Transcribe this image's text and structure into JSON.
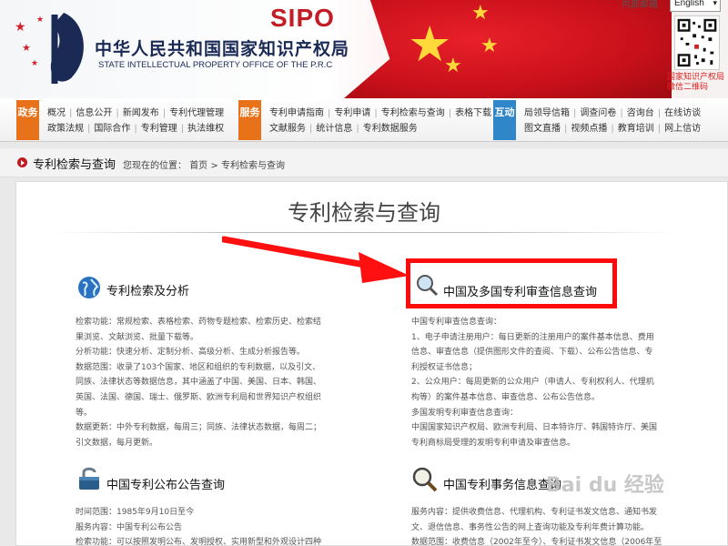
{
  "header": {
    "sipo_logo": "SIPO",
    "cn_title": "中华人民共和国国家知识产权局",
    "en_title": "STATE INTELLECTUAL PROPERTY OFFICE OF THE P.R.C",
    "mail_link": "内部邮箱",
    "language_selected": "English",
    "qr_caption": "国家知识产权局微信二维码",
    "brand_red": "#c21d24",
    "brand_navy": "#1a2a55"
  },
  "nav": {
    "gov": {
      "badge": "政务",
      "row1": [
        "概况",
        "信息公开",
        "新闻发布",
        "专利代理管理"
      ],
      "row2": [
        "政策法规",
        "国际合作",
        "专利管理",
        "执法维权"
      ]
    },
    "service": {
      "badge": "服务",
      "row1": [
        "专利申请指南",
        "专利申请",
        "专利检索与查询",
        "表格下载"
      ],
      "row2": [
        "文献服务",
        "统计信息",
        "专利数据服务"
      ]
    },
    "interact": {
      "badge": "互动",
      "row1": [
        "局领导信箱",
        "调查问卷",
        "咨询台",
        "在线访谈"
      ],
      "row2": [
        "图文直播",
        "视频点播",
        "教育培训",
        "网上信访"
      ]
    }
  },
  "breadcrumb": {
    "title": "专利检索与查询",
    "location_label": "您现在的位置：",
    "home": "首页",
    "separator": ">",
    "current": "专利检索与查询"
  },
  "main": {
    "title": "专利检索与查询",
    "sections": {
      "analysis": {
        "title": "专利检索及分析",
        "lines": [
          "检索功能：常规检索、表格检索、药物专题检索、检索历史、检索结",
          "果浏览、文献浏览、批量下载等。",
          "分析功能：快速分析、定制分析、高级分析、生成分析报告等。",
          "数据范围：收录了103个国家、地区和组织的专利数据，以及引文、",
          "同族、法律状态等数据信息，其中涵盖了中国、美国、日本、韩国、",
          "英国、法国、德国、瑞士、俄罗斯、欧洲专利局和世界知识产权组织",
          "等。",
          "数据更新：中外专利数据，每周三；同族、法律状态数据，每周二；",
          "引文数据，每月更新。"
        ]
      },
      "examination": {
        "title": "中国及多国专利审查信息查询",
        "lines": [
          "中国专利审查信息查询：",
          "1、电子申请注册用户：每日更新的注册用户的案件基本信息、费用",
          "信息、审查信息（提供图形文件的查阅、下载）、公布公告信息、专",
          "利授权证书信息；",
          "2、公众用户：每周更新的公众用户（申请人、专利权利人、代理机",
          "构等）的案件基本信息、审查信息、公布公告信息。",
          "多国发明专利审查信息查询：",
          "中国国家知识产权局、欧洲专利局、日本特许厅、韩国特许厅、美国",
          "专利商标局受理的发明专利申请及审查信息。"
        ]
      },
      "publication": {
        "title": "中国专利公布公告查询",
        "lines": [
          "时间范围：1985年9月10日至今",
          "服务内容：中国专利公布公告",
          "检索功能：可以按照发明公布、发明授权、实用新型和外观设计四种"
        ]
      },
      "affairs": {
        "title": "中国专利事务信息查询",
        "lines": [
          "服务内容：提供收费信息、代理机构、专利证书发文信息、通知书发",
          "文、退信信息、事务性公告的网上查询功能及专利年费计算功能。",
          "数据范围：收费信息（2002年至今）、专利证书发文信息（2006年至"
        ]
      }
    }
  },
  "watermark": "Bai du 经验",
  "annotation_color": "#ff0a0a"
}
